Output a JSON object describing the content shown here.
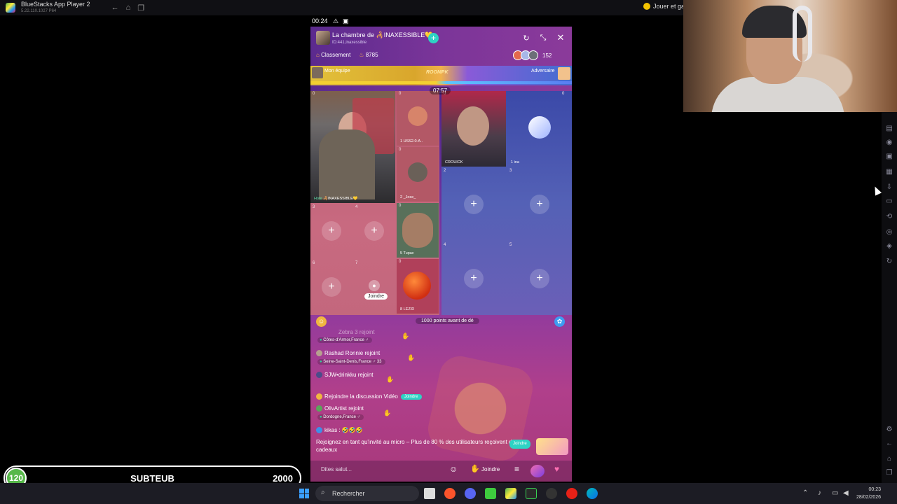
{
  "window": {
    "title": "BlueStacks App Player 2",
    "version": "5.22.110.1027 P64",
    "promo": "Jouer et ga"
  },
  "phone_status": {
    "time": "00:24"
  },
  "room": {
    "title": "La chambre de 🦂INAXESSIBLE💛",
    "id": "ID:441,inaxessible",
    "ranking_label": "Classement",
    "coins": "8785",
    "viewer_count": "152"
  },
  "pk": {
    "my_team": "Mon équipe",
    "center": "ROOMPK",
    "opponent": "Adversaire",
    "timer": "07:57"
  },
  "seats_left": {
    "host_label": "🦂INAXESSIBLE💛",
    "host_tag": "Hote",
    "seat1_name": "USS2.0-A..",
    "seat2_name": "_Jose_",
    "seat5_name": "Tupac",
    "seat8_name": "LEZID",
    "join_label": "Joindre",
    "counts": [
      "0",
      "0",
      "0",
      "0",
      "0"
    ]
  },
  "seats_right": {
    "host_name": "CROUICK",
    "seat1_name": "ina",
    "counts": [
      "0",
      "0"
    ]
  },
  "seat_numbers": [
    "1",
    "2",
    "3",
    "4",
    "5",
    "6",
    "7",
    "8"
  ],
  "chat": {
    "points_text": "1000 points avant de dé",
    "entries": [
      {
        "user": "Zebra 3",
        "action": "rejoint",
        "location": "Côtes-d'Armor,France"
      },
      {
        "user": "Rashad Ronnie",
        "action": "rejoint",
        "location": "Seine-Saint-Denis,France",
        "age": "33"
      },
      {
        "user": "SJW•drinkku",
        "action": "rejoint"
      },
      {
        "system": "Rejoindre la discussion Vidéo",
        "tag": "Joindre"
      },
      {
        "user": "OlivArtist",
        "action": "rejoint",
        "location": "Dordogne,France"
      },
      {
        "user": "kikas",
        "message": "🤣🤣🤣"
      }
    ],
    "invite_text": "Rejoignez en tant qu'invité au micro – Plus de 80 % des utilisateurs reçoivent des cadeaux",
    "invite_tag": "Joindre"
  },
  "bottom_bar": {
    "placeholder": "Dites salut...",
    "join_label": "Joindre"
  },
  "score_overlay": {
    "current": "120",
    "name": "SUBTEUB",
    "goal": "2000"
  },
  "taskbar": {
    "search": "Rechercher",
    "time": "00:23",
    "date": "28/02/2026"
  },
  "icons": {
    "room_share": "refresh-icon",
    "room_minimize": "shrink-icon",
    "room_close": "close-icon"
  }
}
